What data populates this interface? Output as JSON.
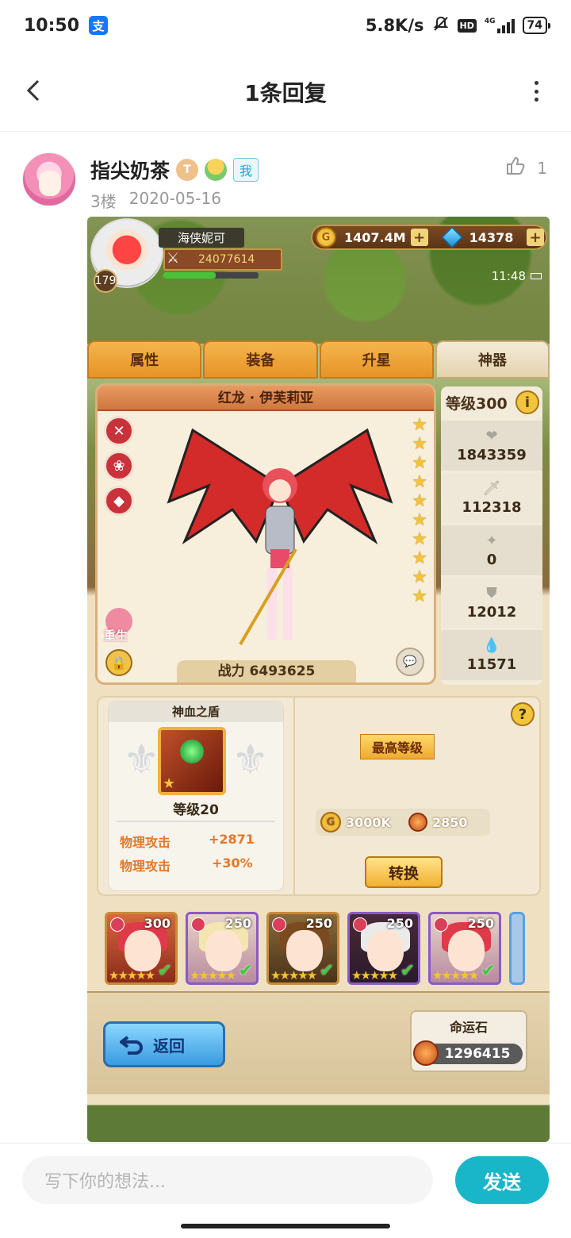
{
  "status_bar": {
    "time": "10:50",
    "alipay_icon": "alipay-icon",
    "net_speed": "5.8K/s",
    "hd_label": "HD",
    "network": "4G",
    "battery": "74"
  },
  "header": {
    "title": "1条回复"
  },
  "post": {
    "username": "指尖奶茶",
    "badge_t": "T",
    "me_tag": "我",
    "floor": "3楼",
    "date": "2020-05-16",
    "like_count": "1"
  },
  "game": {
    "player_name": "海侠妮可",
    "player_power": "24077614",
    "player_level": "179",
    "gold": "1407.4M",
    "gems": "14378",
    "clock": "11:48",
    "tabs": [
      "属性",
      "装备",
      "升星",
      "神器"
    ],
    "active_tab": 3,
    "hero_name": "红龙 · 伊芙莉亚",
    "stars": 10,
    "rebirth_label": "重生",
    "battle_power": "战力 6493625",
    "level_label": "等级300",
    "stats": [
      {
        "icon": "heart-icon",
        "value": "1843359"
      },
      {
        "icon": "sword-icon",
        "value": "112318"
      },
      {
        "icon": "pin-icon",
        "value": "0"
      },
      {
        "icon": "shield-icon",
        "value": "12012"
      },
      {
        "icon": "drop-icon",
        "value": "11571"
      }
    ],
    "artifact": {
      "title": "神血之盾",
      "level": "等级20",
      "attr1_name": "物理攻击",
      "attr1_val": "+2871",
      "attr2_name": "物理攻击",
      "attr2_val": "+30%"
    },
    "max_level_label": "最高等级",
    "cost_gold": "3000K",
    "cost_stone": "2850",
    "convert_label": "转换",
    "heroes": [
      {
        "level": "300"
      },
      {
        "level": "250"
      },
      {
        "level": "250"
      },
      {
        "level": "250"
      },
      {
        "level": "250"
      }
    ],
    "back_label": "返回",
    "fate_title": "命运石",
    "fate_value": "1296415"
  },
  "input": {
    "placeholder": "写下你的想法...",
    "send_label": "发送"
  }
}
